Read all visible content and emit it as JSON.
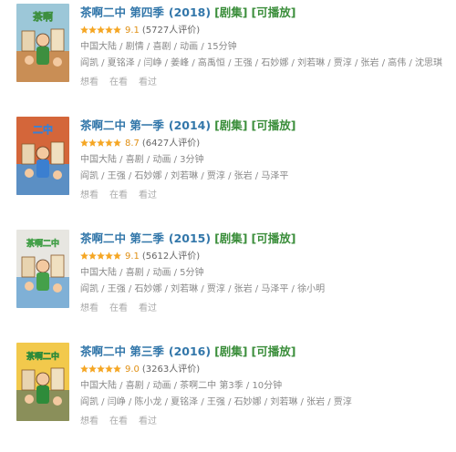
{
  "theme": {
    "link": "#3377aa",
    "tag": "#3b8e3b",
    "star": "#f5a623",
    "score": "#e09015"
  },
  "items": [
    {
      "title": "茶啊二中 第四季",
      "year": "(2018)",
      "tags": [
        "[剧集]",
        "[可播放]"
      ],
      "rating": 4.5,
      "score": "9.1",
      "votes": "(5727人评价)",
      "meta": "中国大陆 / 剧情 / 喜剧 / 动画 / 15分钟",
      "cast": "阎凯 / 夏铭泽 / 闫峥 / 姜峰 / 高禹恒 / 王强 / 石妙娜 / 刘若琳 / 贾淳 / 张岩 / 高伟 / 沈思琪",
      "actions": [
        "想看",
        "在看",
        "看过"
      ],
      "poster": {
        "sky": "#9cc7d8",
        "ground": "#c98e55",
        "accent": "#3d8f3f",
        "label": "茶啊"
      }
    },
    {
      "title": "茶啊二中 第一季",
      "year": "(2014)",
      "tags": [
        "[剧集]",
        "[可播放]"
      ],
      "rating": 4.5,
      "score": "8.7",
      "votes": "(6427人评价)",
      "meta": "中国大陆 / 喜剧 / 动画 / 3分钟",
      "cast": "阎凯 / 王强 / 石妙娜 / 刘若琳 / 贾淳 / 张岩 / 马泽平",
      "actions": [
        "想看",
        "在看",
        "看过"
      ],
      "poster": {
        "sky": "#d4663a",
        "ground": "#5b8fc4",
        "accent": "#3b7fd0",
        "label": "二中"
      }
    },
    {
      "title": "茶啊二中 第二季",
      "year": "(2015)",
      "tags": [
        "[剧集]",
        "[可播放]"
      ],
      "rating": 4.5,
      "score": "9.1",
      "votes": "(5612人评价)",
      "meta": "中国大陆 / 喜剧 / 动画 / 5分钟",
      "cast": "阎凯 / 王强 / 石妙娜 / 刘若琳 / 贾淳 / 张岩 / 马泽平 / 徐小明",
      "actions": [
        "想看",
        "在看",
        "看过"
      ],
      "poster": {
        "sky": "#e7e6e1",
        "ground": "#7fb0d6",
        "accent": "#45a04a",
        "label": "茶啊二中"
      }
    },
    {
      "title": "茶啊二中 第三季",
      "year": "(2016)",
      "tags": [
        "[剧集]",
        "[可播放]"
      ],
      "rating": 4.5,
      "score": "9.0",
      "votes": "(3263人评价)",
      "meta": "中国大陆 / 喜剧 / 动画 / 茶啊二中 第3季 / 10分钟",
      "cast": "阎凯 / 闫峥 / 陈小龙 / 夏铭泽 / 王强 / 石妙娜 / 刘若琳 / 张岩 / 贾淳",
      "actions": [
        "想看",
        "在看",
        "看过"
      ],
      "poster": {
        "sky": "#f2c94c",
        "ground": "#8a8f5a",
        "accent": "#2e8b3a",
        "label": "茶啊二中"
      }
    }
  ]
}
